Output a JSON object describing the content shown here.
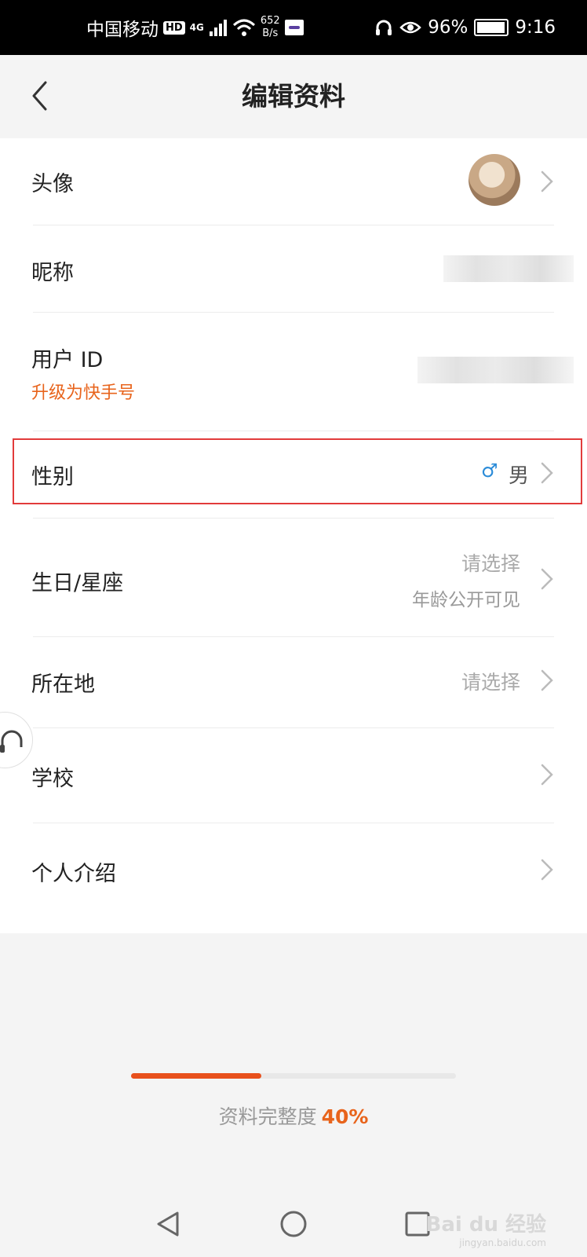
{
  "status_bar": {
    "carrier": "中国移动",
    "hd_badge": "HD",
    "network": "4G",
    "speed_value": "652",
    "speed_unit": "B/s",
    "battery": "96%",
    "time": "9:16"
  },
  "header": {
    "title": "编辑资料"
  },
  "rows": {
    "avatar": {
      "label": "头像"
    },
    "nickname": {
      "label": "昵称"
    },
    "user_id": {
      "label": "用户 ID",
      "link": "升级为快手号"
    },
    "gender": {
      "label": "性别",
      "symbol": "♂",
      "value": "男"
    },
    "birthday": {
      "label": "生日/星座",
      "value": "请选择",
      "note": "年龄公开可见"
    },
    "location": {
      "label": "所在地",
      "value": "请选择"
    },
    "school": {
      "label": "学校"
    },
    "intro": {
      "label": "个人介绍"
    }
  },
  "completeness": {
    "label": "资料完整度",
    "percent_text": "40%",
    "percent": 40
  },
  "watermark": {
    "brand": "Bai du 经验",
    "url": "jingyan.baidu.com"
  },
  "colors": {
    "accent": "#e8641c",
    "highlight_border": "#e23b3b",
    "male_icon": "#2a8bd8"
  }
}
